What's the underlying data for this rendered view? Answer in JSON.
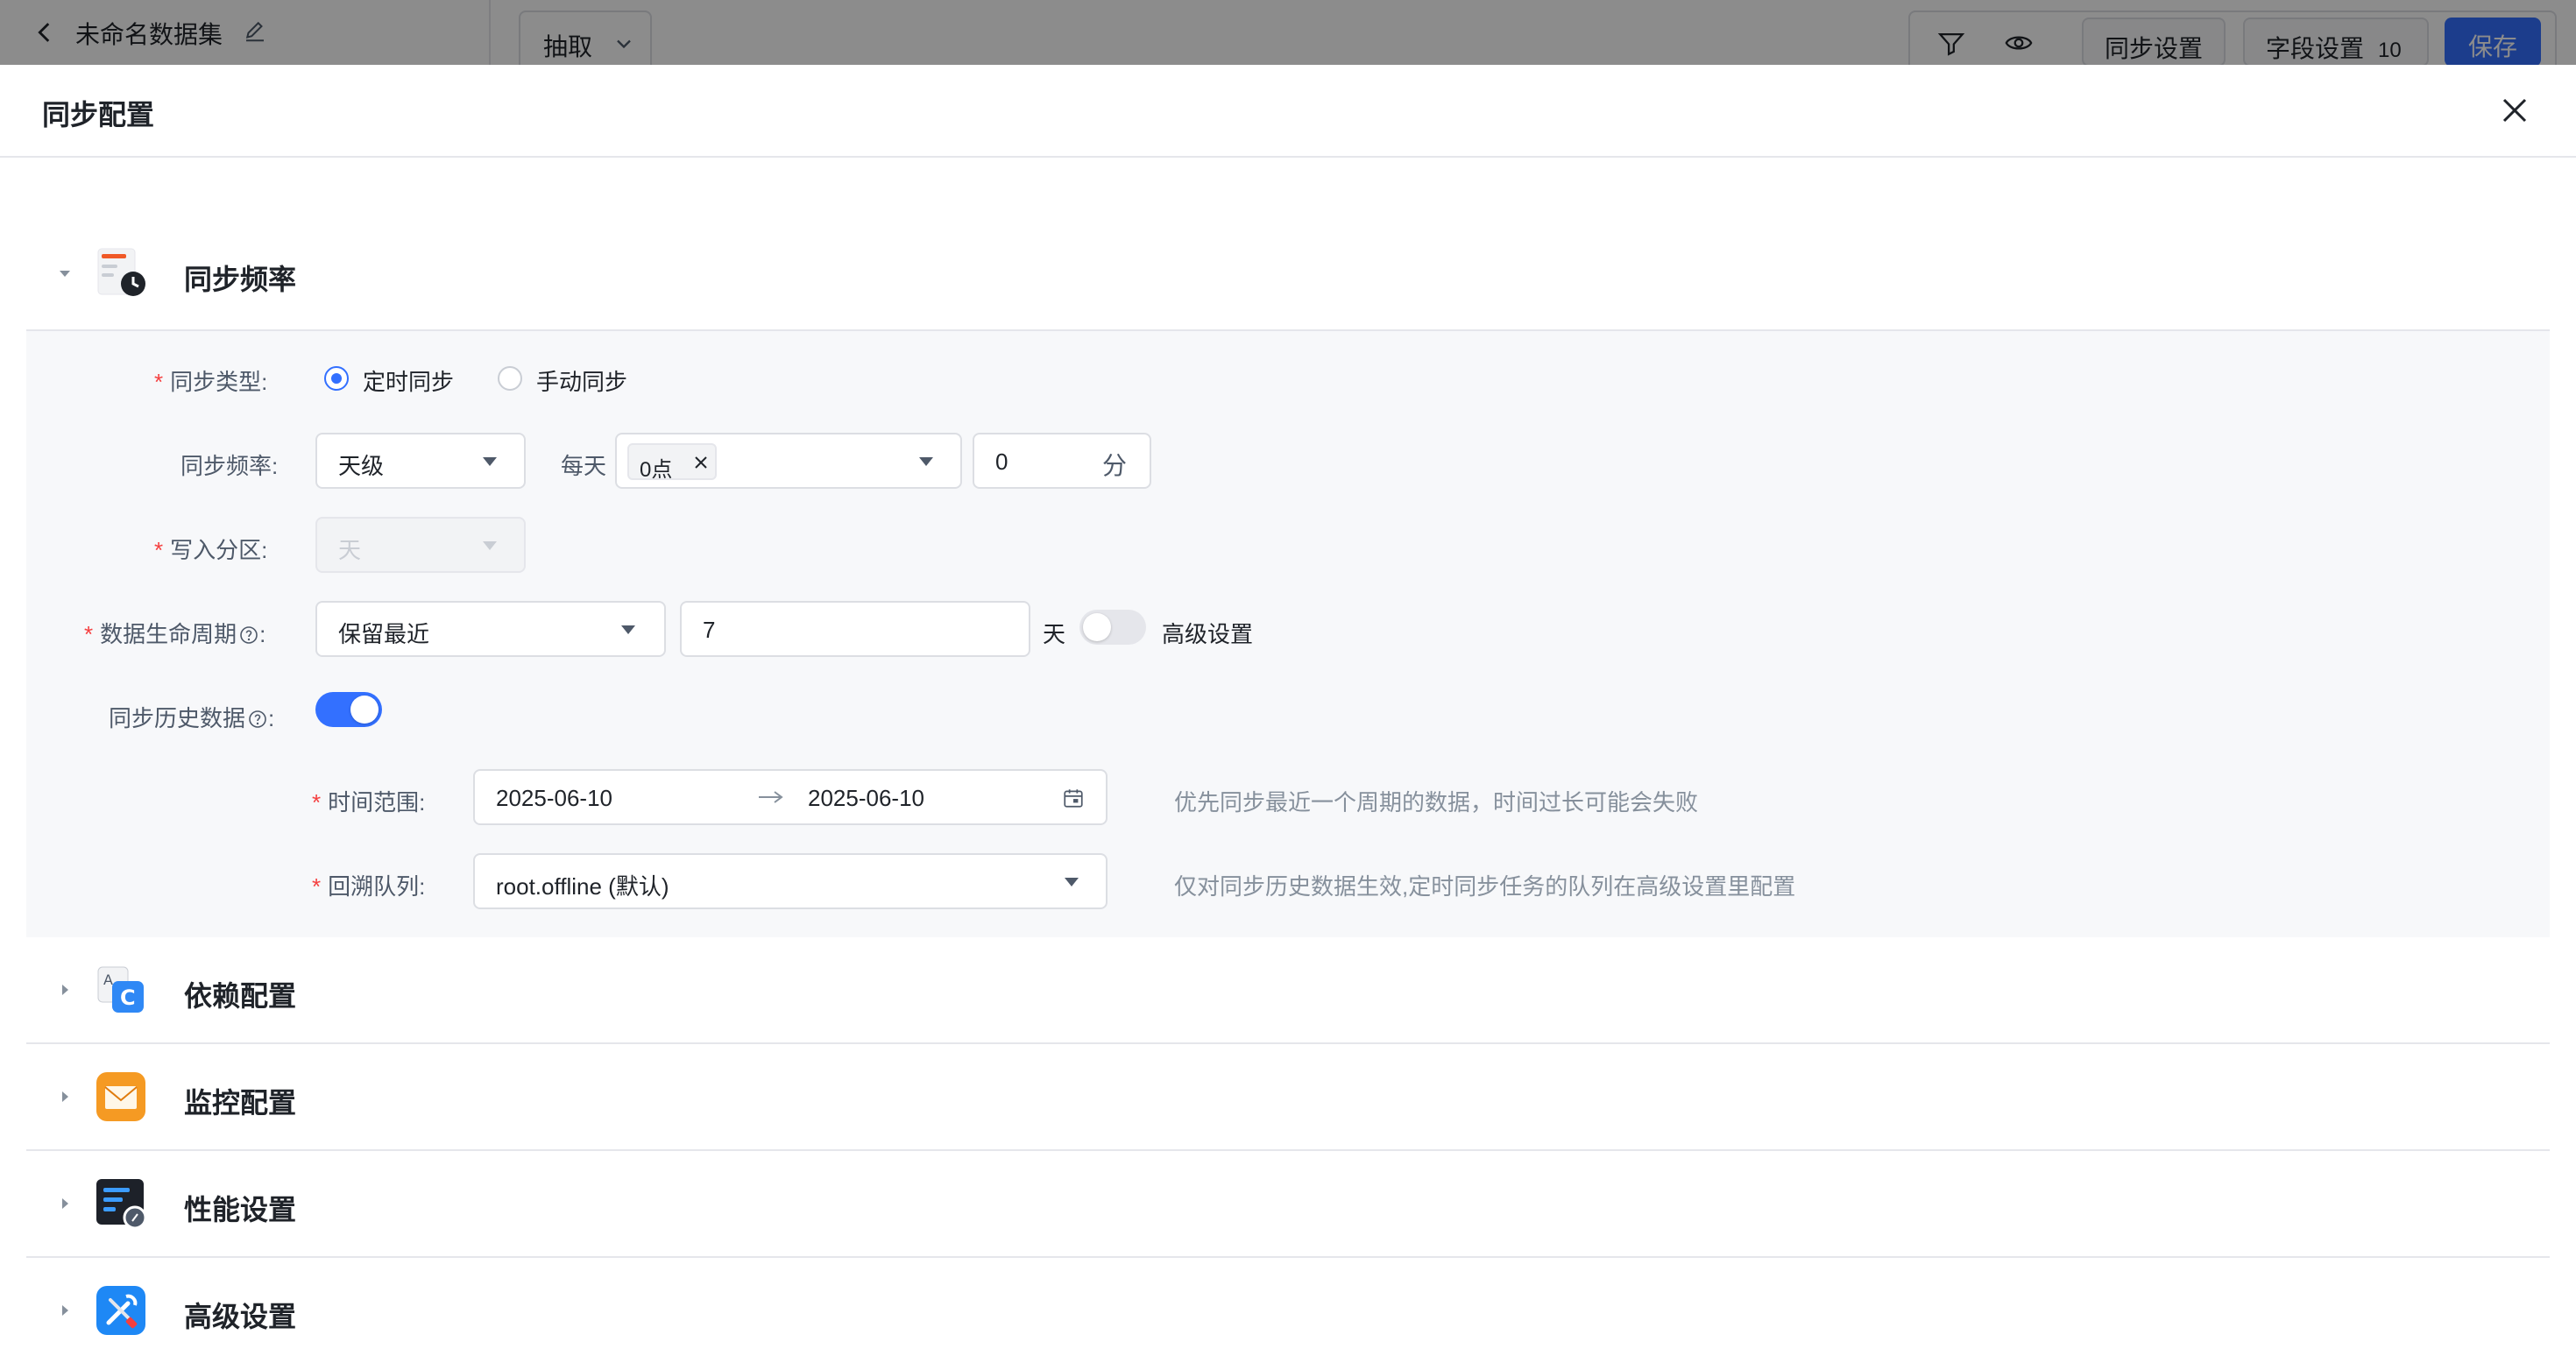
{
  "background": {
    "title": "未命名数据集",
    "extract_label": "抽取",
    "sync_settings_label": "同步设置",
    "field_settings_label": "字段设置",
    "field_settings_count": "10",
    "save_label": "保存"
  },
  "drawer": {
    "title": "同步配置"
  },
  "sections": {
    "sync_frequency": {
      "title": "同步频率",
      "expanded": true,
      "form": {
        "sync_type": {
          "label": "同步类型:",
          "required": true,
          "options": [
            "定时同步",
            "手动同步"
          ],
          "selected": "定时同步"
        },
        "frequency": {
          "label": "同步频率:",
          "unit_value": "天级",
          "daily_label": "每天",
          "hour_tag": "0点",
          "minute_value": "0",
          "minute_suffix": "分"
        },
        "partition": {
          "label": "写入分区:",
          "required": true,
          "value": "天",
          "disabled": true
        },
        "lifecycle": {
          "label": "数据生命周期",
          "label_suffix": ":",
          "required": true,
          "mode": "保留最近",
          "days": "7",
          "days_unit": "天",
          "advanced_label": "高级设置",
          "advanced_enabled": false
        },
        "history": {
          "label": "同步历史数据",
          "label_suffix": ":",
          "enabled": true
        },
        "time_range": {
          "label": "时间范围:",
          "required": true,
          "start": "2025-06-10",
          "end": "2025-06-10",
          "hint": "优先同步最近一个周期的数据，时间过长可能会失败"
        },
        "backfill_queue": {
          "label": "回溯队列:",
          "required": true,
          "value": "root.offline (默认)",
          "hint": "仅对同步历史数据生效,定时同步任务的队列在高级设置里配置"
        }
      }
    },
    "dependency": {
      "title": "依赖配置",
      "expanded": false
    },
    "monitoring": {
      "title": "监控配置",
      "expanded": false
    },
    "performance": {
      "title": "性能设置",
      "expanded": false
    },
    "advanced": {
      "title": "高级设置",
      "expanded": false
    }
  },
  "colors": {
    "primary": "#3370ff",
    "required": "#f53f3f",
    "form_background": "#f7f8fa",
    "border": "#e5e6eb"
  }
}
